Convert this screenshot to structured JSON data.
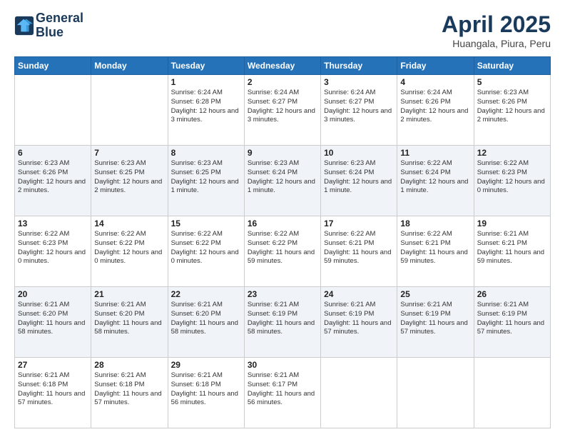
{
  "logo": {
    "line1": "General",
    "line2": "Blue"
  },
  "title": "April 2025",
  "subtitle": "Huangala, Piura, Peru",
  "days_of_week": [
    "Sunday",
    "Monday",
    "Tuesday",
    "Wednesday",
    "Thursday",
    "Friday",
    "Saturday"
  ],
  "weeks": [
    [
      {
        "num": "",
        "detail": ""
      },
      {
        "num": "",
        "detail": ""
      },
      {
        "num": "1",
        "detail": "Sunrise: 6:24 AM\nSunset: 6:28 PM\nDaylight: 12 hours and 3 minutes."
      },
      {
        "num": "2",
        "detail": "Sunrise: 6:24 AM\nSunset: 6:27 PM\nDaylight: 12 hours and 3 minutes."
      },
      {
        "num": "3",
        "detail": "Sunrise: 6:24 AM\nSunset: 6:27 PM\nDaylight: 12 hours and 3 minutes."
      },
      {
        "num": "4",
        "detail": "Sunrise: 6:24 AM\nSunset: 6:26 PM\nDaylight: 12 hours and 2 minutes."
      },
      {
        "num": "5",
        "detail": "Sunrise: 6:23 AM\nSunset: 6:26 PM\nDaylight: 12 hours and 2 minutes."
      }
    ],
    [
      {
        "num": "6",
        "detail": "Sunrise: 6:23 AM\nSunset: 6:26 PM\nDaylight: 12 hours and 2 minutes."
      },
      {
        "num": "7",
        "detail": "Sunrise: 6:23 AM\nSunset: 6:25 PM\nDaylight: 12 hours and 2 minutes."
      },
      {
        "num": "8",
        "detail": "Sunrise: 6:23 AM\nSunset: 6:25 PM\nDaylight: 12 hours and 1 minute."
      },
      {
        "num": "9",
        "detail": "Sunrise: 6:23 AM\nSunset: 6:24 PM\nDaylight: 12 hours and 1 minute."
      },
      {
        "num": "10",
        "detail": "Sunrise: 6:23 AM\nSunset: 6:24 PM\nDaylight: 12 hours and 1 minute."
      },
      {
        "num": "11",
        "detail": "Sunrise: 6:22 AM\nSunset: 6:24 PM\nDaylight: 12 hours and 1 minute."
      },
      {
        "num": "12",
        "detail": "Sunrise: 6:22 AM\nSunset: 6:23 PM\nDaylight: 12 hours and 0 minutes."
      }
    ],
    [
      {
        "num": "13",
        "detail": "Sunrise: 6:22 AM\nSunset: 6:23 PM\nDaylight: 12 hours and 0 minutes."
      },
      {
        "num": "14",
        "detail": "Sunrise: 6:22 AM\nSunset: 6:22 PM\nDaylight: 12 hours and 0 minutes."
      },
      {
        "num": "15",
        "detail": "Sunrise: 6:22 AM\nSunset: 6:22 PM\nDaylight: 12 hours and 0 minutes."
      },
      {
        "num": "16",
        "detail": "Sunrise: 6:22 AM\nSunset: 6:22 PM\nDaylight: 11 hours and 59 minutes."
      },
      {
        "num": "17",
        "detail": "Sunrise: 6:22 AM\nSunset: 6:21 PM\nDaylight: 11 hours and 59 minutes."
      },
      {
        "num": "18",
        "detail": "Sunrise: 6:22 AM\nSunset: 6:21 PM\nDaylight: 11 hours and 59 minutes."
      },
      {
        "num": "19",
        "detail": "Sunrise: 6:21 AM\nSunset: 6:21 PM\nDaylight: 11 hours and 59 minutes."
      }
    ],
    [
      {
        "num": "20",
        "detail": "Sunrise: 6:21 AM\nSunset: 6:20 PM\nDaylight: 11 hours and 58 minutes."
      },
      {
        "num": "21",
        "detail": "Sunrise: 6:21 AM\nSunset: 6:20 PM\nDaylight: 11 hours and 58 minutes."
      },
      {
        "num": "22",
        "detail": "Sunrise: 6:21 AM\nSunset: 6:20 PM\nDaylight: 11 hours and 58 minutes."
      },
      {
        "num": "23",
        "detail": "Sunrise: 6:21 AM\nSunset: 6:19 PM\nDaylight: 11 hours and 58 minutes."
      },
      {
        "num": "24",
        "detail": "Sunrise: 6:21 AM\nSunset: 6:19 PM\nDaylight: 11 hours and 57 minutes."
      },
      {
        "num": "25",
        "detail": "Sunrise: 6:21 AM\nSunset: 6:19 PM\nDaylight: 11 hours and 57 minutes."
      },
      {
        "num": "26",
        "detail": "Sunrise: 6:21 AM\nSunset: 6:19 PM\nDaylight: 11 hours and 57 minutes."
      }
    ],
    [
      {
        "num": "27",
        "detail": "Sunrise: 6:21 AM\nSunset: 6:18 PM\nDaylight: 11 hours and 57 minutes."
      },
      {
        "num": "28",
        "detail": "Sunrise: 6:21 AM\nSunset: 6:18 PM\nDaylight: 11 hours and 57 minutes."
      },
      {
        "num": "29",
        "detail": "Sunrise: 6:21 AM\nSunset: 6:18 PM\nDaylight: 11 hours and 56 minutes."
      },
      {
        "num": "30",
        "detail": "Sunrise: 6:21 AM\nSunset: 6:17 PM\nDaylight: 11 hours and 56 minutes."
      },
      {
        "num": "",
        "detail": ""
      },
      {
        "num": "",
        "detail": ""
      },
      {
        "num": "",
        "detail": ""
      }
    ]
  ]
}
